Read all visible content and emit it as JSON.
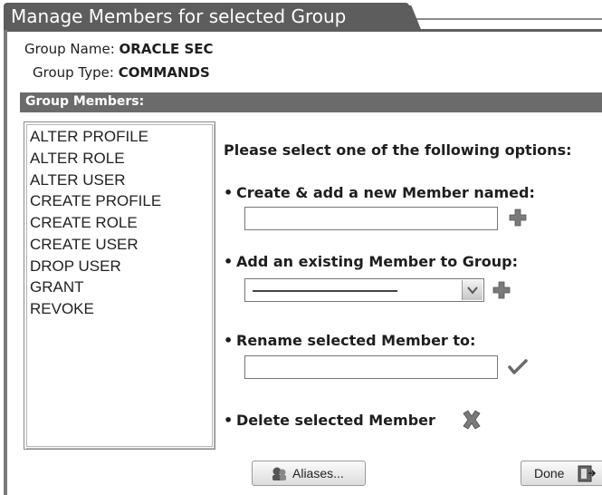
{
  "dialog": {
    "title": "Manage Members for selected Group"
  },
  "group": {
    "name_label": "Group Name:",
    "name_value": "ORACLE SEC",
    "type_label": "Group Type:",
    "type_value": "COMMANDS"
  },
  "members_section": {
    "header": "Group Members:",
    "items": [
      "ALTER PROFILE",
      "ALTER ROLE",
      "ALTER USER",
      "CREATE PROFILE",
      "CREATE ROLE",
      "CREATE USER",
      "DROP USER",
      "GRANT",
      "REVOKE"
    ]
  },
  "options": {
    "prompt": "Please select one of the following options:",
    "bullet": "•",
    "create_label": "Create & add a new Member named:",
    "create_value": "",
    "add_existing_label": "Add an existing Member to Group:",
    "add_existing_selected": "",
    "rename_label": "Rename selected Member to:",
    "rename_value": "",
    "delete_label": "Delete selected Member"
  },
  "buttons": {
    "aliases_label": "Aliases...",
    "done_label": "Done"
  },
  "icons": {
    "create_add": "plus-icon",
    "existing_add": "plus-icon",
    "rename_confirm": "checkmark-icon",
    "delete": "x-icon",
    "aliases": "aliases-icon",
    "done": "exit-icon",
    "dropdown": "chevron-down-icon"
  },
  "colors": {
    "title_bar": "#5d5d5d",
    "section_bar": "#6b6b6b",
    "icon_gray": "#7a7a7a"
  }
}
